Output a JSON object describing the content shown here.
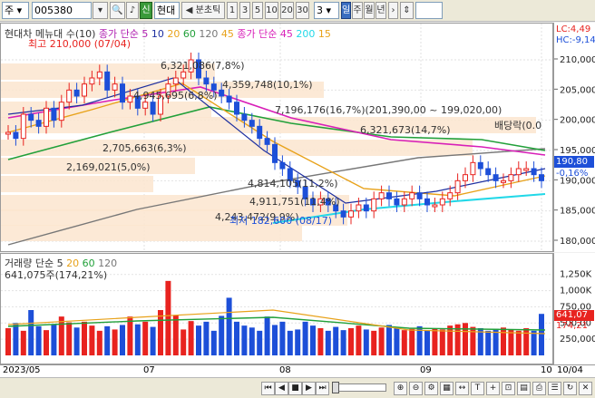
{
  "toolbar": {
    "market": "주",
    "code": "005380",
    "credit_label": "신",
    "stock_name": "현대",
    "mode_label": "◀ 분초틱",
    "periods": [
      "1",
      "3",
      "5",
      "10",
      "20",
      "30"
    ],
    "period_value": "3",
    "day_label": "일",
    "week_label": "주",
    "month_label": "월",
    "year_label": "년"
  },
  "colors": {
    "up": "#e8231f",
    "down": "#1d4fd8",
    "ma5": "#1d2fa0",
    "ma20": "#e8a21a",
    "ma60": "#22a03a",
    "ma120": "#777777",
    "ma45": "#d81fb8",
    "ma200": "#22d8e8"
  },
  "price_chart": {
    "legend_left": "현대차 메뉴대 수(10)",
    "legend_ma": "종가 단순 5",
    "legend_ma_periods": [
      "10",
      "20",
      "60",
      "120",
      "45"
    ],
    "legend_ma2": "종가 단순 45",
    "legend_ma2_periods": [
      "200",
      "15"
    ],
    "lc": "LC:4,49",
    "hc": "HC:-9,14",
    "high_label": "최고 210,000 (07/04)",
    "low_label": "최저 182,600 (08/17)",
    "dividend_label": "배당락(0.0",
    "price_badge": "190,80",
    "change_label": "-0,16%",
    "volume_profile": [
      {
        "label": "6,321,086(7,8%)"
      },
      {
        "label": "4,359,748(10,1%)"
      },
      {
        "label": "4,945,695(6,8%)"
      },
      {
        "label": "7,196,176(16,7%)(201,390,00 ~ 199,020,00)"
      },
      {
        "label": "6,321,673(14,7%)"
      },
      {
        "label": "2,705,663(6,3%)"
      },
      {
        "label": "2,169,021(5,0%)"
      },
      {
        "label": "4,814,105(11,2%)"
      },
      {
        "label": "4,911,751(11,4%)"
      },
      {
        "label": "4,243,472(9,9%)"
      }
    ],
    "y_ticks": [
      "210,000",
      "205,000",
      "200,000",
      "195,000",
      "190,000",
      "185,000",
      "180,000"
    ],
    "x_ticks": [
      "2023/05",
      "07",
      "08",
      "09",
      "10",
      "10/04"
    ]
  },
  "volume_chart": {
    "legend": "거래량 단순 5",
    "legend_periods": [
      "20",
      "60",
      "120"
    ],
    "last_volume": "641,075주(174,21%)",
    "y_ticks": [
      "1,250K",
      "1,000K",
      "750,00",
      "500,00",
      "250,000"
    ],
    "badge": "641,07",
    "pct": "174,21"
  }
}
